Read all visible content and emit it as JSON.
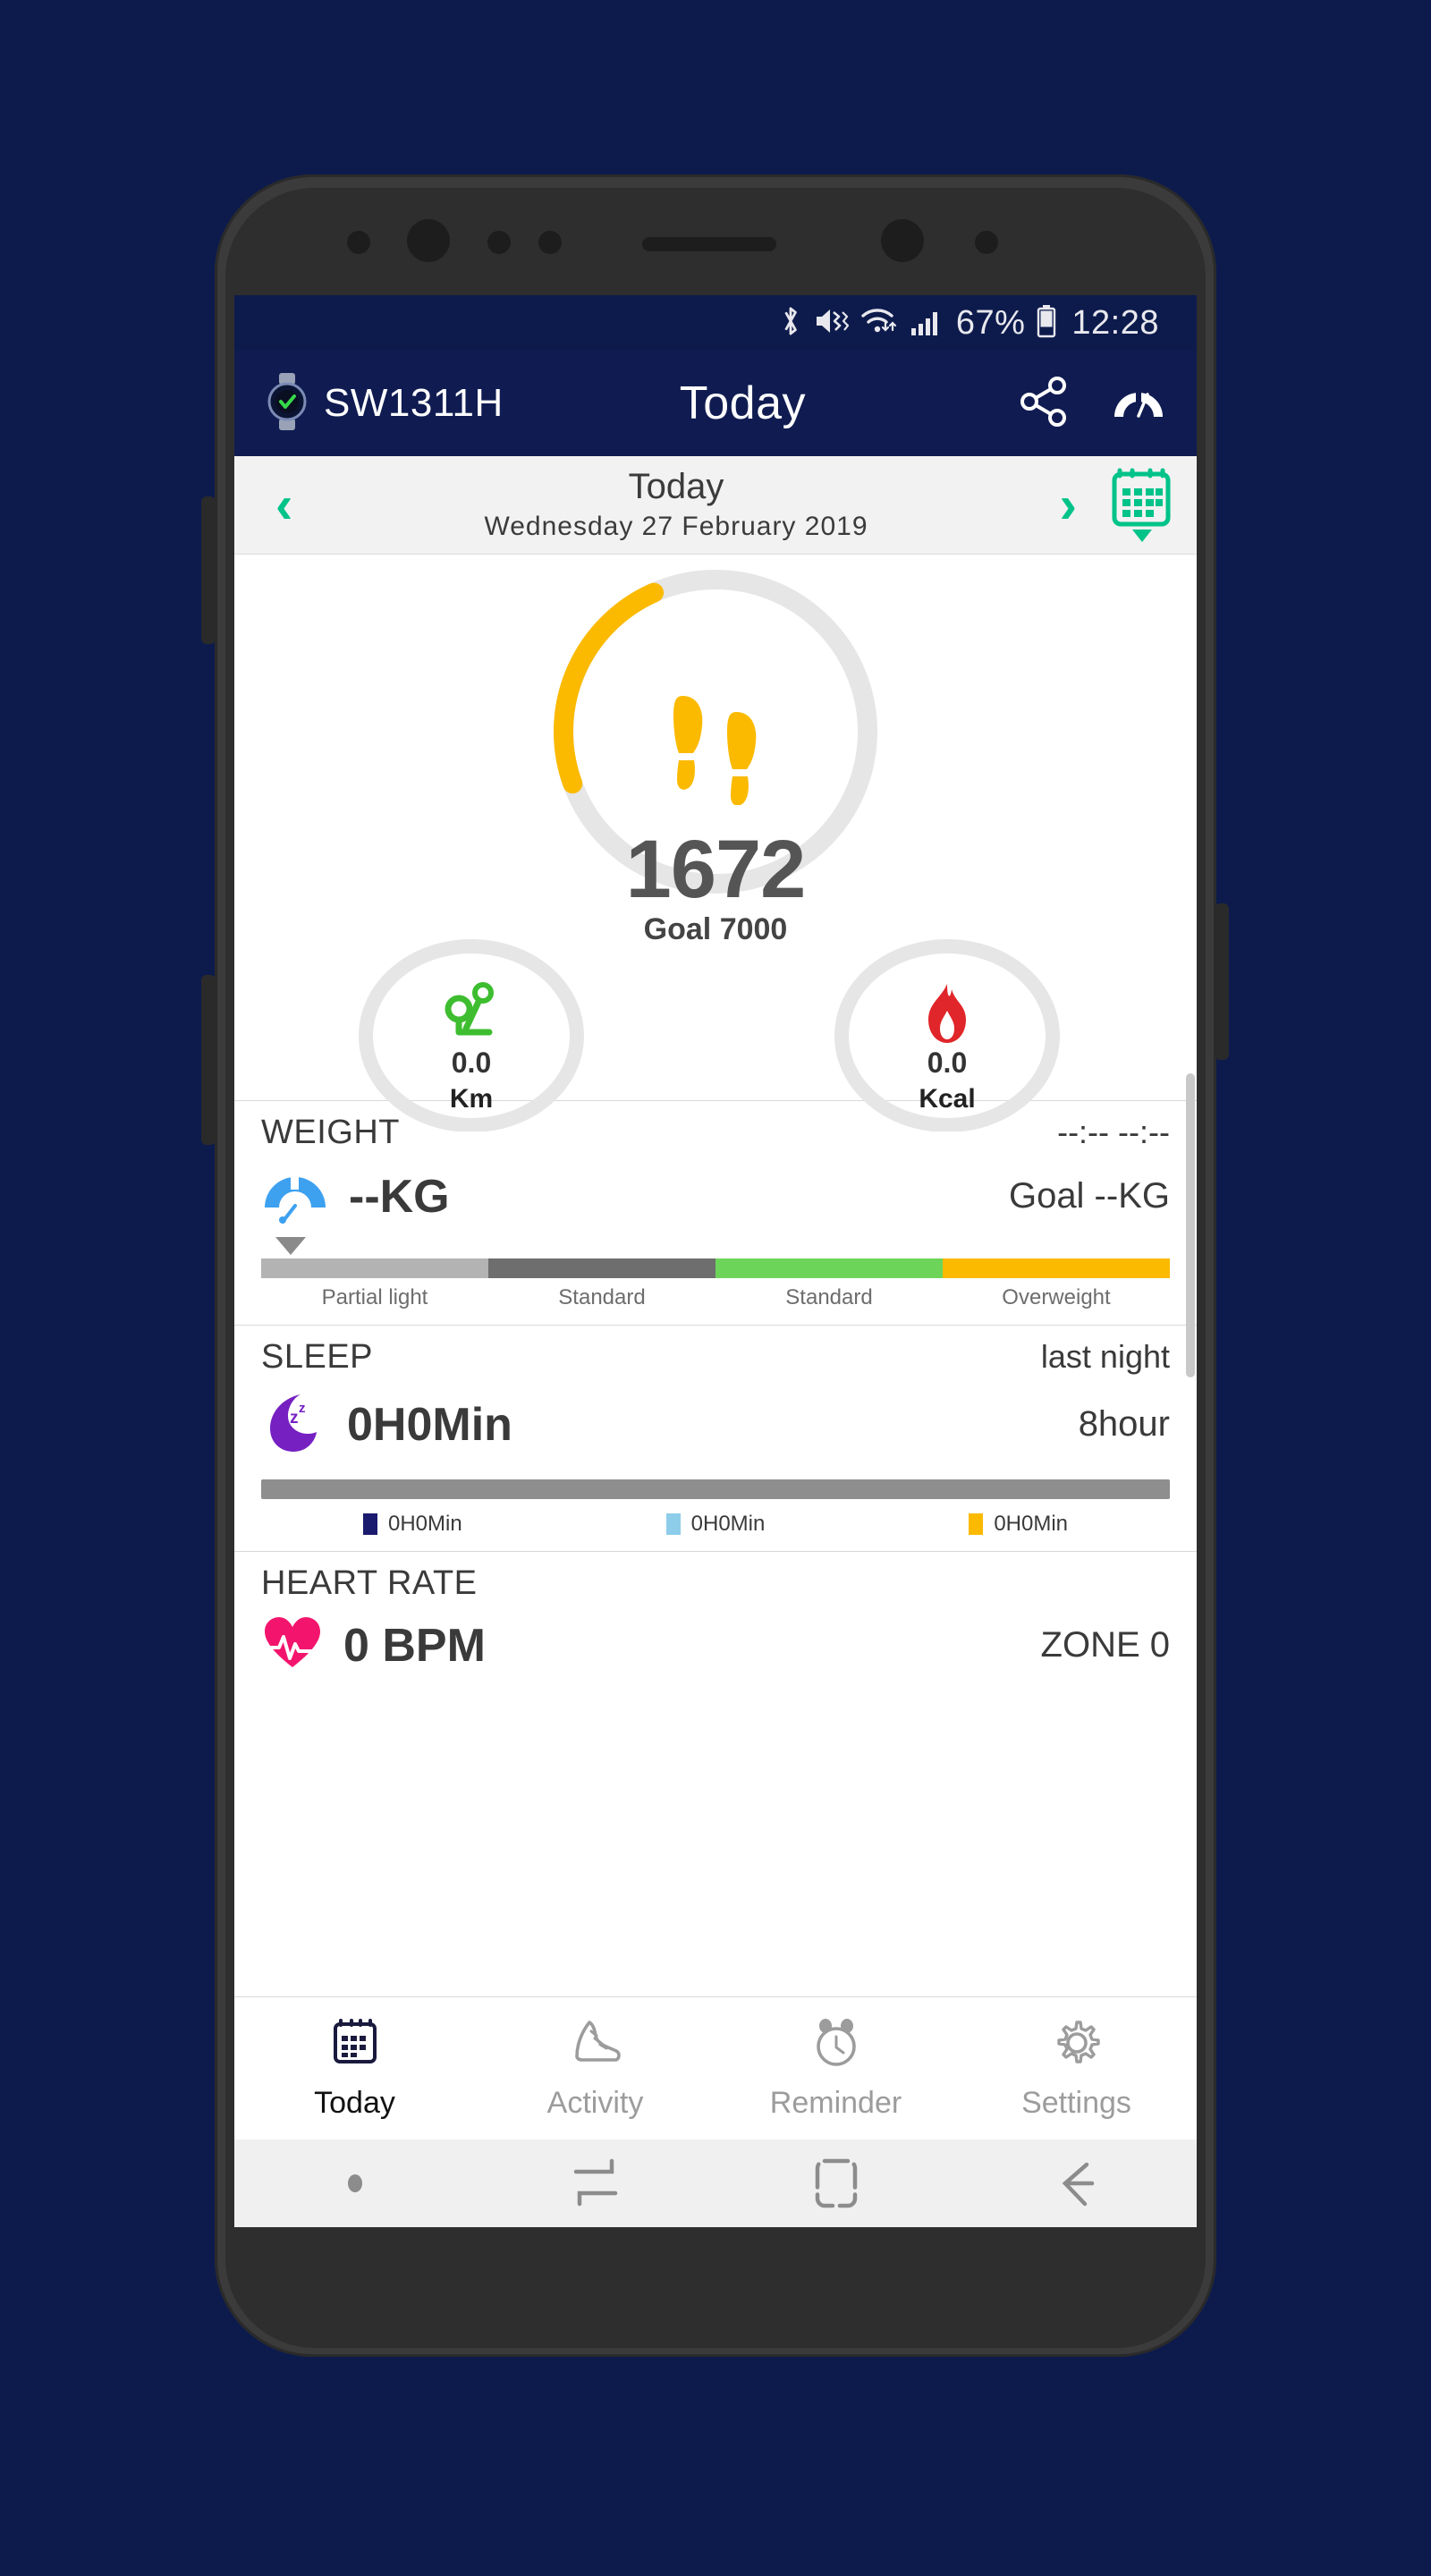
{
  "status_bar": {
    "icons": [
      "bluetooth-icon",
      "mute-vibrate-icon",
      "wifi-icon",
      "signal-icon",
      "battery-icon"
    ],
    "battery_percent": "67%",
    "time": "12:28"
  },
  "app_header": {
    "device_name": "SW1311H",
    "device_icon": "watch-connected-icon",
    "title": "Today",
    "share_icon": "share-icon",
    "dashboard_icon": "speedometer-icon",
    "background": "#101c51"
  },
  "date_bar": {
    "prev_icon": "chevron-left-icon",
    "next_icon": "chevron-right-icon",
    "today_label": "Today",
    "full_date": "Wednesday  27  February  2019",
    "calendar_icon": "calendar-icon",
    "accent": "#00c389"
  },
  "rings": {
    "steps": {
      "icon": "footsteps-icon",
      "value": "1672",
      "goal_label": "Goal 7000",
      "goal_value": 7000,
      "current_value": 1672,
      "percent": 23.9,
      "color": "#fbba00",
      "track_color": "#e6e6e6"
    },
    "distance": {
      "icon": "route-pin-icon",
      "value": "0.0",
      "unit": "Km",
      "percent": 0,
      "color": "#3dbd2f"
    },
    "calories": {
      "icon": "flame-icon",
      "value": "0.0",
      "unit": "Kcal",
      "percent": 0,
      "color": "#e0262a"
    }
  },
  "weight_card": {
    "title": "WEIGHT",
    "timestamp": "--:--  --:--",
    "icon": "weight-scale-icon",
    "value": "--KG",
    "goal_label": "Goal  --KG",
    "segments": [
      {
        "label": "Partial light",
        "color": "#b3b3b3"
      },
      {
        "label": "Standard",
        "color": "#6e6e6e"
      },
      {
        "label": "Standard",
        "color": "#6dd45a"
      },
      {
        "label": "Overweight",
        "color": "#fbba00"
      }
    ]
  },
  "sleep_card": {
    "title": "SLEEP",
    "subtitle": "last night",
    "icon": "sleep-moon-icon",
    "value": "0H0Min",
    "goal": "8hour",
    "bar_color": "#8e8e8e",
    "legend": [
      {
        "color": "#1a1a6e",
        "label": "0H0Min"
      },
      {
        "color": "#8ecdea",
        "label": "0H0Min"
      },
      {
        "color": "#fbba00",
        "label": "0H0Min"
      }
    ]
  },
  "heart_card": {
    "title": "HEART RATE",
    "icon": "heartbeat-icon",
    "value": "0 BPM",
    "zone": "ZONE 0"
  },
  "tab_bar": {
    "tabs": [
      {
        "label": "Today",
        "icon": "calendar-icon",
        "active": true
      },
      {
        "label": "Activity",
        "icon": "shoe-icon",
        "active": false
      },
      {
        "label": "Reminder",
        "icon": "alarm-clock-icon",
        "active": false
      },
      {
        "label": "Settings",
        "icon": "gear-icon",
        "active": false
      }
    ]
  },
  "android_nav": {
    "buttons": [
      "dot-indicator",
      "recents-icon",
      "home-icon",
      "back-icon"
    ]
  }
}
